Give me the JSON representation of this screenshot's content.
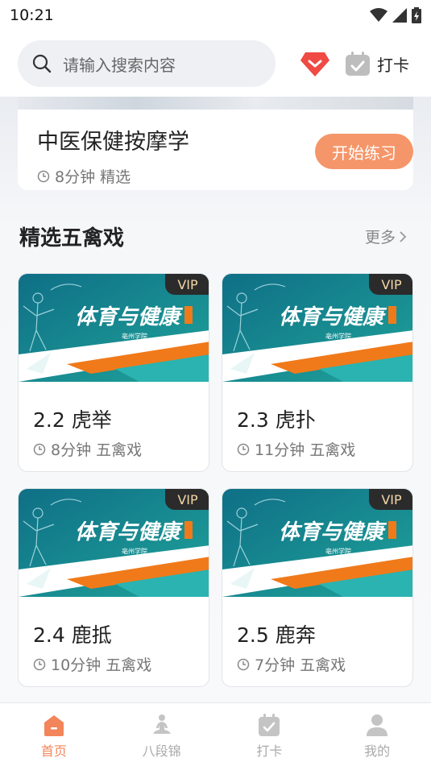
{
  "status": {
    "time": "10:21"
  },
  "header": {
    "search_placeholder": "请输入搜索内容",
    "checkin_label": "打卡"
  },
  "hero": {
    "title": "中医保健按摩学",
    "duration": "8分钟",
    "category": "精选",
    "start_label": "开始练习"
  },
  "section": {
    "title": "精选五禽戏",
    "more_label": "更多"
  },
  "thumbnail": {
    "banner_text": "体育与健康",
    "sub_text": "亳州学院",
    "badge": "VIP"
  },
  "courses": [
    {
      "title": "2.2 虎举",
      "duration": "8分钟",
      "category": "五禽戏"
    },
    {
      "title": "2.3 虎扑",
      "duration": "11分钟",
      "category": "五禽戏"
    },
    {
      "title": "2.4 鹿抵",
      "duration": "10分钟",
      "category": "五禽戏"
    },
    {
      "title": "2.5 鹿奔",
      "duration": "7分钟",
      "category": "五禽戏"
    }
  ],
  "nav": [
    {
      "label": "首页",
      "icon": "home-icon",
      "active": true
    },
    {
      "label": "八段锦",
      "icon": "meditation-icon",
      "active": false
    },
    {
      "label": "打卡",
      "icon": "calendar-check-icon",
      "active": false
    },
    {
      "label": "我的",
      "icon": "user-icon",
      "active": false
    }
  ],
  "colors": {
    "accent": "#f5966a",
    "nav_active": "#f3855a",
    "teal": "#1a8f8c"
  }
}
